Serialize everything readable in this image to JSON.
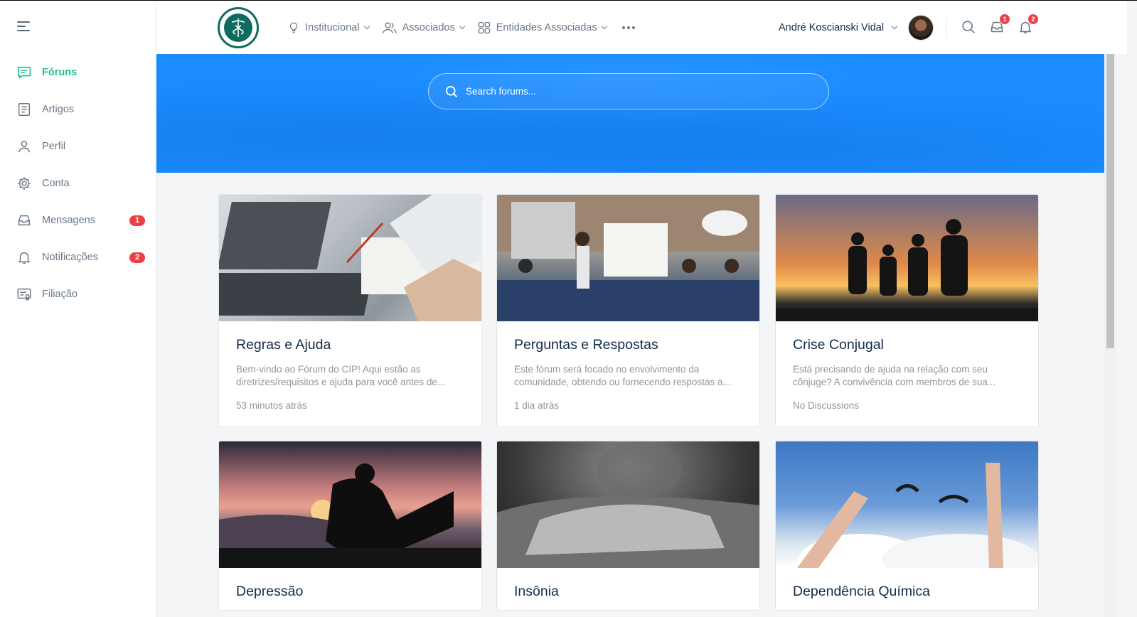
{
  "sidebar": {
    "items": [
      {
        "label": "Fóruns",
        "icon": "forum-icon",
        "active": true,
        "badge": null
      },
      {
        "label": "Artigos",
        "icon": "article-icon",
        "active": false,
        "badge": null
      },
      {
        "label": "Perfil",
        "icon": "user-icon",
        "active": false,
        "badge": null
      },
      {
        "label": "Conta",
        "icon": "gear-icon",
        "active": false,
        "badge": null
      },
      {
        "label": "Mensagens",
        "icon": "inbox-icon",
        "active": false,
        "badge": "1"
      },
      {
        "label": "Notificações",
        "icon": "bell-icon",
        "active": false,
        "badge": "2"
      },
      {
        "label": "Filiação",
        "icon": "membership-icon",
        "active": false,
        "badge": null
      }
    ]
  },
  "header": {
    "menu": [
      {
        "label": "Institucional",
        "icon": "lightbulb-icon"
      },
      {
        "label": "Associados",
        "icon": "users-icon"
      },
      {
        "label": "Entidades Associadas",
        "icon": "grid-icon"
      }
    ],
    "user_name": "André Koscianski Vidal",
    "messages_badge": "1",
    "notifications_badge": "2"
  },
  "search": {
    "placeholder": "Search forums..."
  },
  "forums": [
    {
      "title": "Regras e Ajuda",
      "desc": "Bem-vindo ao Fórum do CIP! Aqui estão as diretrizes/requisitos e ajuda para você antes de...",
      "meta": "53 minutos atrás"
    },
    {
      "title": "Perguntas e Respostas",
      "desc": "Este fórum será focado no envolvimento da comunidade, obtendo ou fornecendo respostas a...",
      "meta": "1 dia atrás"
    },
    {
      "title": "Crise Conjugal",
      "desc": "Está precisando de ajuda na relação com seu cônjuge? A convivência com membros de sua...",
      "meta": "No Discussions"
    },
    {
      "title": "Depressão",
      "desc": "",
      "meta": ""
    },
    {
      "title": "Insônia",
      "desc": "",
      "meta": ""
    },
    {
      "title": "Dependência Química",
      "desc": "",
      "meta": ""
    }
  ],
  "colors": {
    "accent": "#1cc38b",
    "hero": "#1a8cff",
    "badge": "#ef3e46"
  }
}
